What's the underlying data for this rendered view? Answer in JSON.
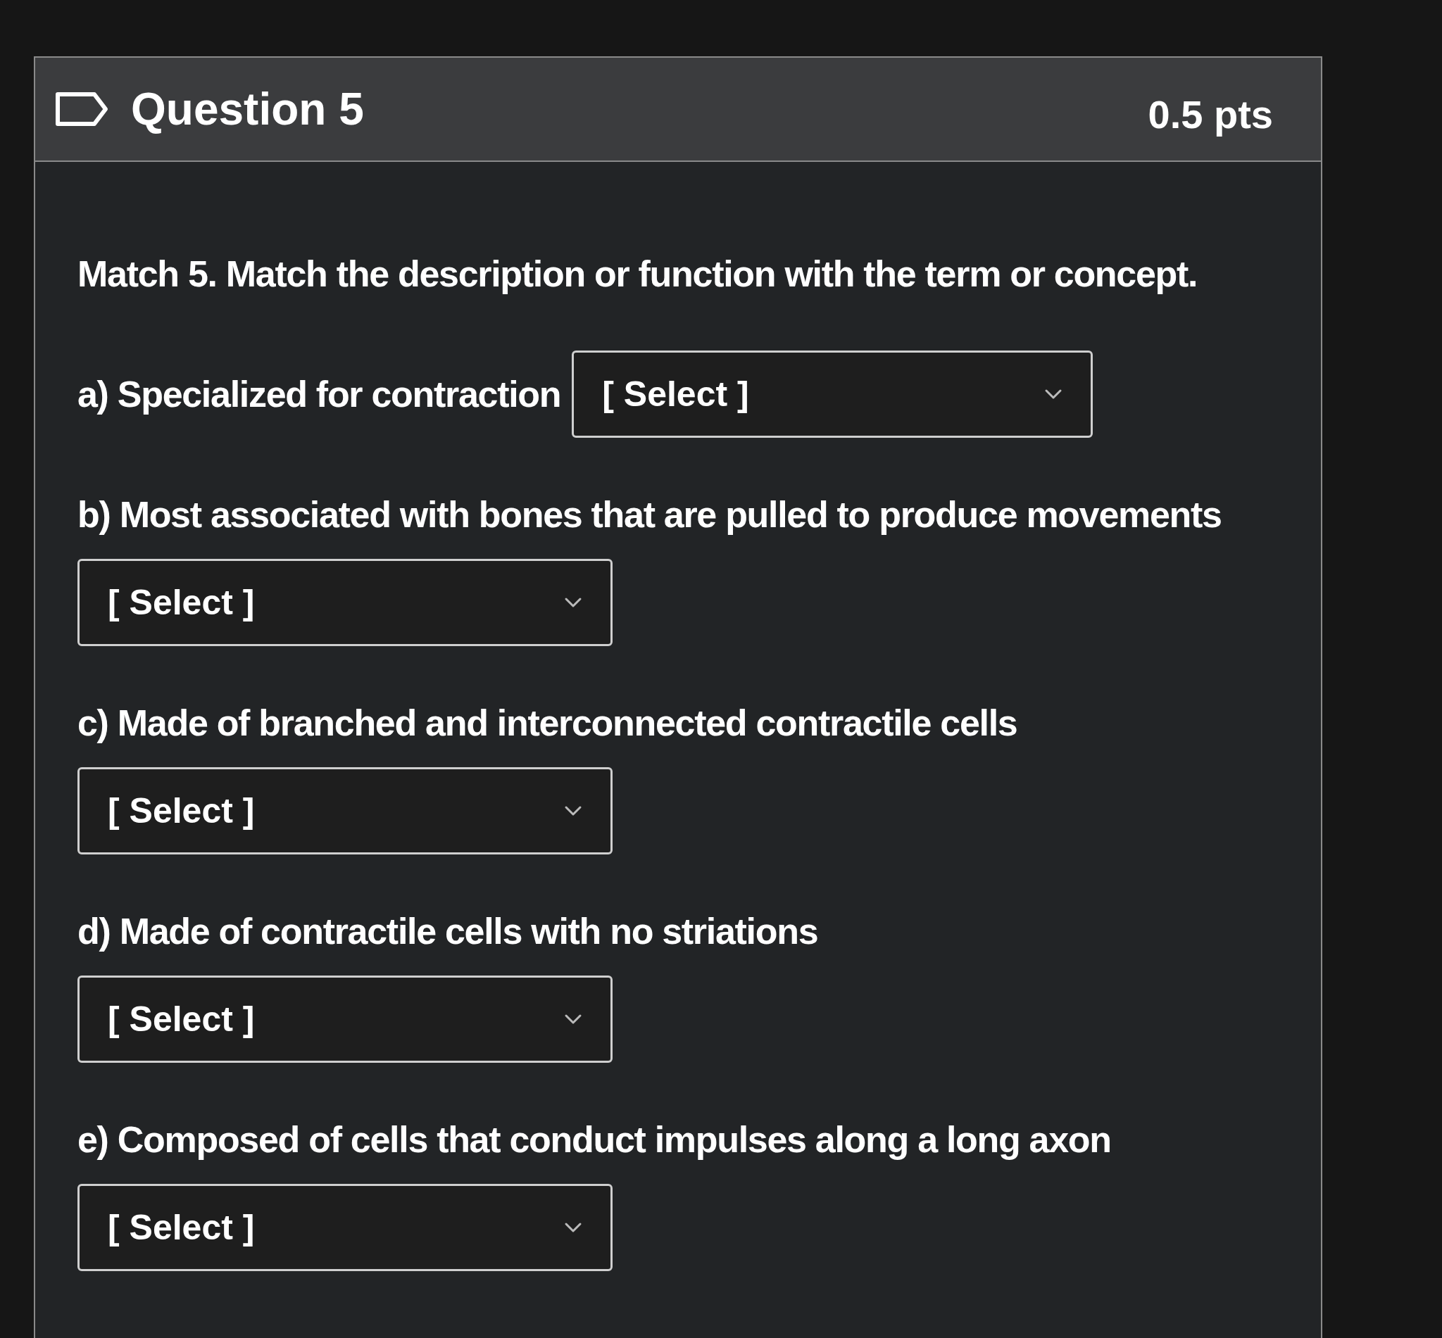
{
  "question": {
    "title": "Question 5",
    "points": "0.5 pts"
  },
  "prompt": "Match 5. Match the description or function with the term or concept.",
  "items": [
    {
      "kind": "inline",
      "label": "a) Specialized for contraction",
      "value": "[ Select ]"
    },
    {
      "kind": "stacked",
      "label": "b) Most associated with bones that are pulled to produce movements",
      "value": "[ Select ]"
    },
    {
      "kind": "stacked",
      "label": "c) Made of branched and interconnected contractile cells",
      "value": "[ Select ]"
    },
    {
      "kind": "stacked",
      "label": "d) Made of contractile cells with no striations",
      "value": "[ Select ]"
    },
    {
      "kind": "stacked",
      "label": "e) Composed of cells that conduct impulses along a long axon",
      "value": "[ Select ]"
    }
  ]
}
